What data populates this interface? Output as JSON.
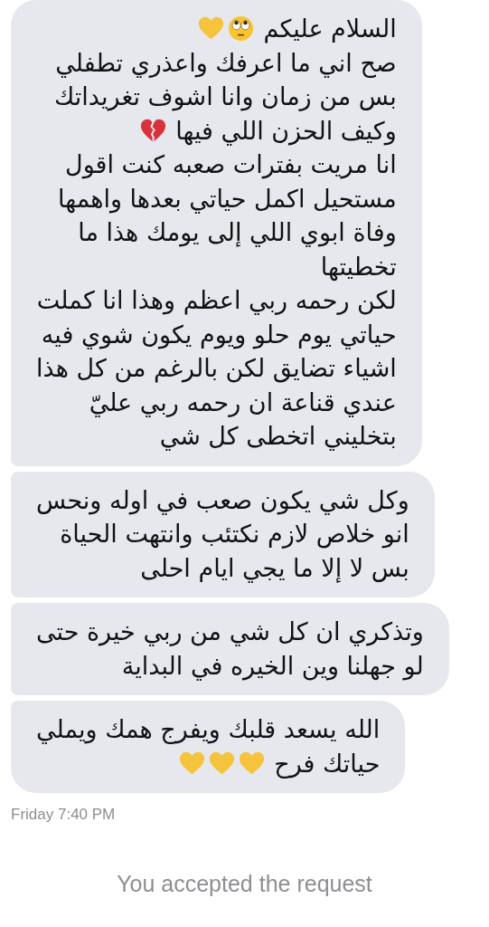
{
  "messages": [
    {
      "lines": [
        {
          "text": "السلام عليكم",
          "emoji": [
            {
              "kind": "eye-roll"
            },
            {
              "kind": "yellow-heart"
            }
          ]
        },
        {
          "text": "صح اني ما اعرفك واعذري تطفلي"
        },
        {
          "text": "بس من زمان وانا اشوف تغريداتك"
        },
        {
          "text": "وكيف الحزن اللي فيها",
          "emoji": [
            {
              "kind": "broken-heart"
            }
          ]
        },
        {
          "text": "انا مريت بفترات صعبه كنت اقول"
        },
        {
          "text": "مستحيل اكمل حياتي بعدها واهمها"
        },
        {
          "text": "وفاة ابوي اللي إلى يومك هذا ما"
        },
        {
          "text": "تخطيتها"
        },
        {
          "text": "لكن رحمه ربي اعظم وهذا انا كملت"
        },
        {
          "text": "حياتي يوم حلو ويوم يكون شوي فيه"
        },
        {
          "text": "اشياء تضايق لكن بالرغم من كل هذا"
        },
        {
          "text": "عندي قناعة ان رحمه ربي عليّ"
        },
        {
          "text": "بتخليني اتخطى كل شي"
        }
      ]
    },
    {
      "lines": [
        {
          "text": "وكل شي يكون صعب في اوله ونحس"
        },
        {
          "text": "انو خلاص لازم نكتئب وانتهت الحياة"
        },
        {
          "text": "بس لا إلا ما يجي ايام احلى"
        }
      ]
    },
    {
      "lines": [
        {
          "text": "وتذكري ان كل شي من ربي خيرة حتى"
        },
        {
          "text": "لو جهلنا وين الخيره في البداية"
        }
      ]
    },
    {
      "lines": [
        {
          "text": "الله يسعد قلبك ويفرج همك ويملي"
        },
        {
          "text": "حياتك فرح",
          "emoji": [
            {
              "kind": "yellow-heart"
            },
            {
              "kind": "yellow-heart"
            },
            {
              "kind": "yellow-heart"
            }
          ]
        }
      ]
    }
  ],
  "timestamp": "Friday 7:40 PM",
  "status": "You accepted the request"
}
